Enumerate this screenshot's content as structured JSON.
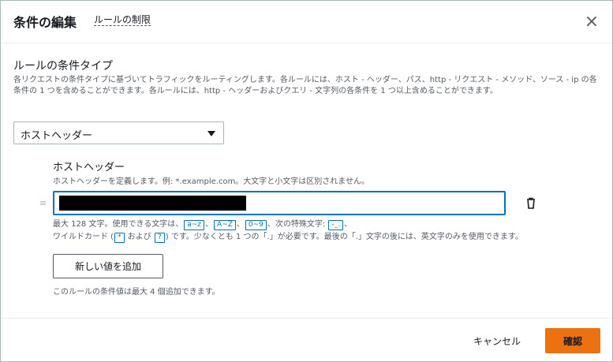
{
  "dialog": {
    "title": "条件の編集",
    "title_link": "ルールの制限",
    "close_icon": "×"
  },
  "condition_type": {
    "label": "ルールの条件タイプ",
    "description": "各リクエストの条件タイプに基づいてトラフィックをルーティングします。各ルールには、ホスト - ヘッダー、パス、http - リクエスト - メソッド、ソース - ip の各条件の 1 つを含めることができます。各ルールには、http - ヘッダーおよびクエリ - 文字列の各条件を 1 つ以上含めることができます。",
    "selected_value": "ホストヘッダー"
  },
  "host_header": {
    "label": "ホストヘッダー",
    "description": "ホストヘッダーを定義します。例: *.example.com。大文字と小文字は区別されません。",
    "input_value": "",
    "drag_handle": "≡",
    "hint": {
      "line1_prefix": "最大 128 文字。使用できる文字は、",
      "chip_az": "a~z",
      "sep1": "、",
      "chip_AZ": "A~Z",
      "sep2": "、",
      "chip_09": "0~9",
      "sep3": "、次の特殊文字: ",
      "chip_special": "-_.",
      "sep4": "、",
      "line2_prefix": "ワイルドカード (",
      "chip_star": "*",
      "and": " および ",
      "chip_q": "?",
      "line2_suffix": ") です。少なくとも 1 つの「.」が必要です。最後の「.」文字の後には、英文字のみを使用できます。"
    }
  },
  "add_value_button": "新しい値を追加",
  "limit_note": "このルールの条件値は最大 4 個追加できます。",
  "footer": {
    "cancel": "キャンセル",
    "confirm": "確認"
  },
  "colors": {
    "accent": "#0073bb",
    "primary_button": "#ec7211"
  }
}
